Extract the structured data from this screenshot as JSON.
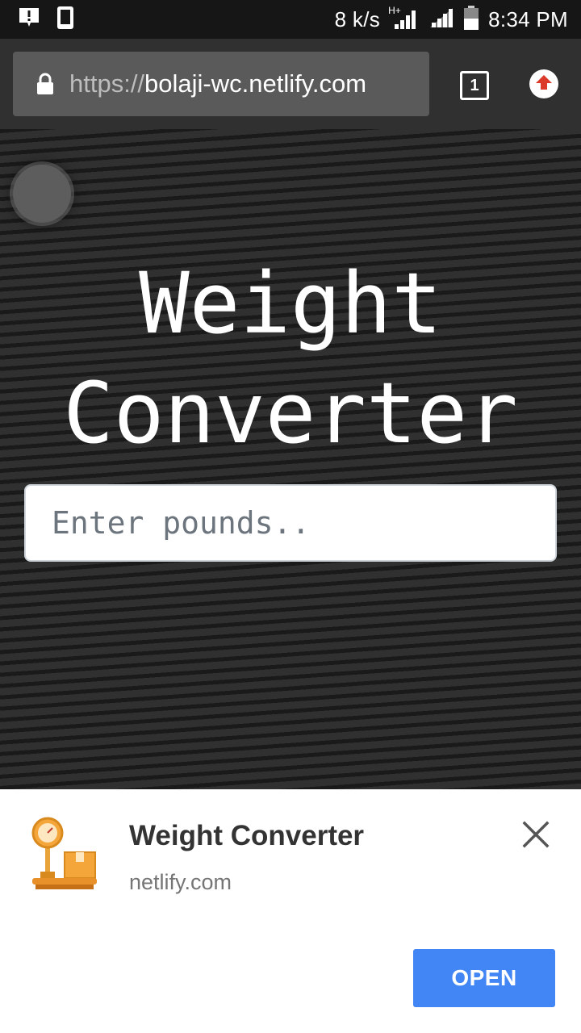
{
  "status_bar": {
    "speed": "8 k/s",
    "network": "H+",
    "time": "8:34 PM",
    "icons": [
      "alert-notification-icon",
      "phone-icon",
      "signal-icon",
      "signal-icon",
      "battery-icon"
    ]
  },
  "browser": {
    "url_scheme": "https://",
    "url_host": "bolaji-wc.netlify.com",
    "tab_count": "1",
    "icons": [
      "lock-icon",
      "tab-switcher-icon",
      "update-arrow-icon"
    ]
  },
  "page": {
    "title_line1": "Weight",
    "title_line2": "Converter",
    "input_placeholder": "Enter pounds..",
    "input_value": ""
  },
  "install_banner": {
    "app_name": "Weight Converter",
    "domain": "netlify.com",
    "open_label": "OPEN",
    "icons": [
      "scale-app-icon",
      "close-icon"
    ]
  },
  "colors": {
    "open_button": "#4285f4",
    "update_arrow": "#db3a2a",
    "toolbar": "#303030",
    "page_background": "#262626"
  }
}
